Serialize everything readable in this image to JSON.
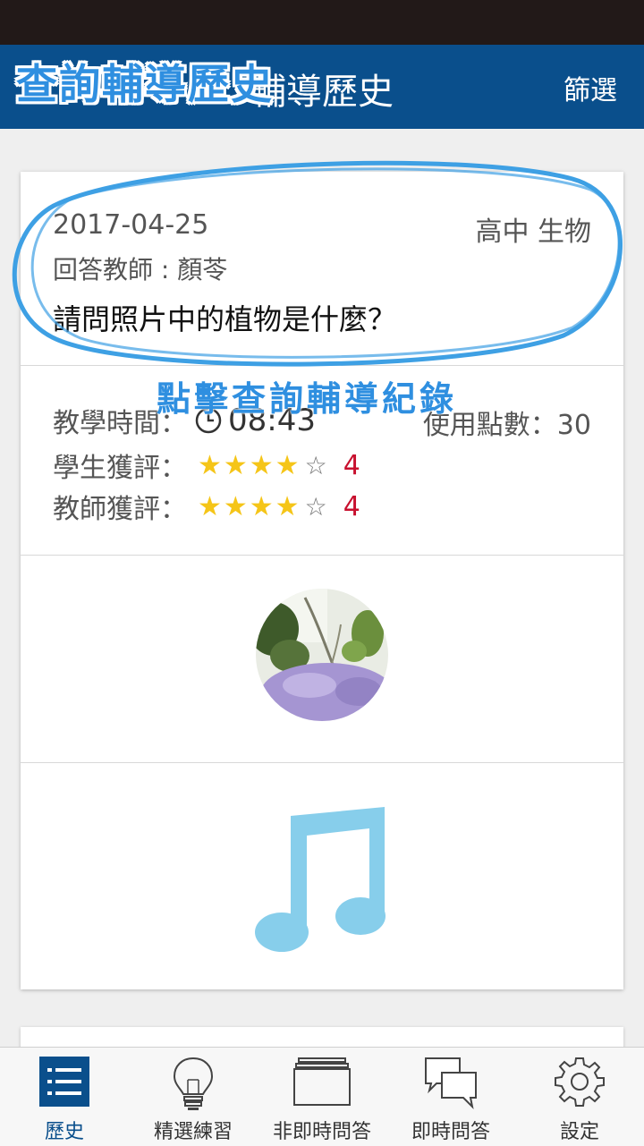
{
  "header": {
    "title": "輔導歷史",
    "overlay_title": "查詢輔導歷史",
    "filter_label": "篩選"
  },
  "record": {
    "date": "2017-04-25",
    "subject": "高中 生物",
    "teacher": "回答教師 : 顏苓",
    "question": "請問照片中的植物是什麼？",
    "teaching_time_label": "教學時間：",
    "teaching_time_value": "08:43",
    "points_label": "使用點數：30",
    "student_rating_label": "學生獲評：",
    "student_rating_value": "4",
    "teacher_rating_label": "教師獲評：",
    "teacher_rating_value": "4",
    "stars_filled": "★★★★",
    "star_empty": "☆"
  },
  "annotation": {
    "caption": "點擊查詢輔導紀錄"
  },
  "tabs": [
    {
      "label": "歷史",
      "icon": "list-icon",
      "active": true
    },
    {
      "label": "精選練習",
      "icon": "lightbulb-icon",
      "active": false
    },
    {
      "label": "非即時問答",
      "icon": "stacked-pages-icon",
      "active": false
    },
    {
      "label": "即時問答",
      "icon": "chat-bubbles-icon",
      "active": false
    },
    {
      "label": "設定",
      "icon": "gear-icon",
      "active": false
    }
  ],
  "colors": {
    "header_bg": "#0a4f8c",
    "annotation": "#2f8fe0",
    "star": "#f5c518",
    "rating_number": "#c8102e",
    "music_icon": "#87ceeb"
  }
}
